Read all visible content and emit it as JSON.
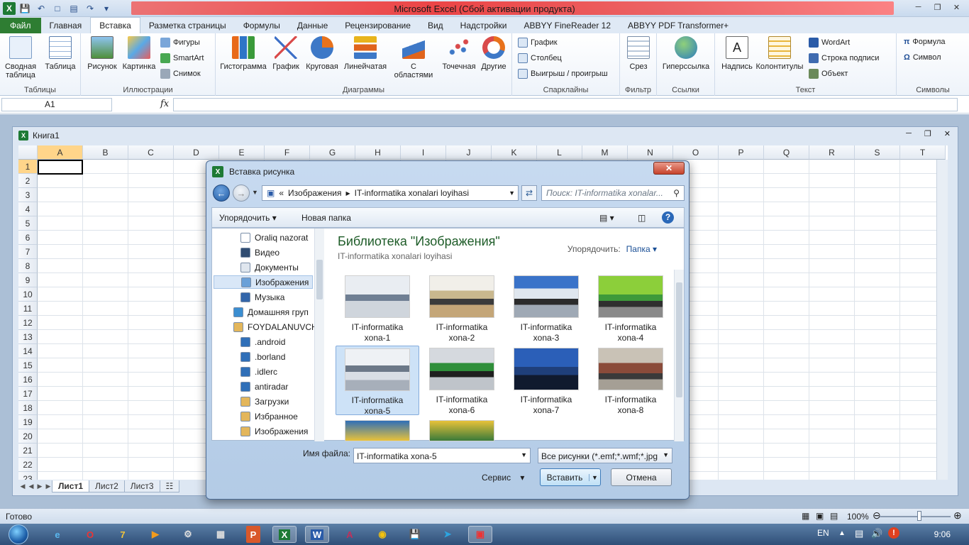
{
  "app": {
    "title": "Microsoft Excel (Сбой активации продукта)"
  },
  "ribbon": {
    "tabs": [
      "Файл",
      "Главная",
      "Вставка",
      "Разметка страницы",
      "Формулы",
      "Данные",
      "Рецензирование",
      "Вид",
      "Надстройки",
      "ABBYY FineReader 12",
      "ABBYY PDF Transformer+"
    ],
    "active_tab": "Вставка",
    "groups": {
      "tables": {
        "label": "Таблицы",
        "pivot": "Сводная таблица",
        "table": "Таблица"
      },
      "illustrations": {
        "label": "Иллюстрации",
        "picture": "Рисунок",
        "clipart": "Картинка",
        "shapes": "Фигуры",
        "smartart": "SmartArt",
        "screenshot": "Снимок"
      },
      "charts": {
        "label": "Диаграммы",
        "column": "Гистограмма",
        "line": "График",
        "pie": "Круговая",
        "bar": "Линейчатая",
        "area": "С областями",
        "scatter": "Точечная",
        "other": "Другие"
      },
      "sparklines": {
        "label": "Спарклайны",
        "line": "График",
        "column": "Столбец",
        "winloss": "Выигрыш / проигрыш"
      },
      "filter": {
        "label": "Фильтр",
        "slicer": "Срез"
      },
      "links": {
        "label": "Ссылки",
        "hyperlink": "Гиперссылка"
      },
      "text": {
        "label": "Текст",
        "textbox": "Надпись",
        "header": "Колонтитулы",
        "wordart": "WordArt",
        "signature": "Строка подписи",
        "object": "Объект"
      },
      "symbols": {
        "label": "Символы",
        "equation": "Формула",
        "symbol": "Символ"
      }
    }
  },
  "formula_bar": {
    "name_box": "A1",
    "fx": "fx",
    "value": ""
  },
  "workbook": {
    "title": "Книга1",
    "columns": [
      "A",
      "B",
      "C",
      "D",
      "E",
      "F",
      "G",
      "H",
      "I",
      "J",
      "K",
      "L",
      "M",
      "N",
      "O",
      "P",
      "Q",
      "R",
      "S",
      "T"
    ],
    "rows": [
      "1",
      "2",
      "3",
      "4",
      "5",
      "6",
      "7",
      "8",
      "9",
      "10",
      "11",
      "12",
      "13",
      "14",
      "15",
      "16",
      "17",
      "18",
      "19",
      "20",
      "21",
      "22",
      "23"
    ],
    "selected_cell": "A1",
    "sheets": [
      "Лист1",
      "Лист2",
      "Лист3"
    ],
    "active_sheet": "Лист1"
  },
  "status": {
    "ready": "Готово",
    "zoom": "100%"
  },
  "dialog": {
    "title": "Вставка рисунка",
    "breadcrumb": [
      "Изображения",
      "IT-informatika  xonalari loyihasi"
    ],
    "search_placeholder": "Поиск: IT-informatika  xonalar...",
    "organize": "Упорядочить",
    "new_folder": "Новая папка",
    "nav_items": [
      {
        "label": "Oraliq nazorat",
        "icon": "document-icon"
      },
      {
        "label": "Видео",
        "icon": "video-library-icon"
      },
      {
        "label": "Документы",
        "icon": "documents-library-icon"
      },
      {
        "label": "Изображения",
        "icon": "pictures-library-icon",
        "selected": true
      },
      {
        "label": "Музыка",
        "icon": "music-library-icon"
      },
      {
        "label": "Домашняя груп",
        "icon": "homegroup-icon"
      },
      {
        "label": "FOYDALANUVCH",
        "icon": "user-folder-icon"
      },
      {
        "label": ".android",
        "icon": "folder-icon"
      },
      {
        "label": ".borland",
        "icon": "folder-icon"
      },
      {
        "label": ".idlerc",
        "icon": "folder-icon"
      },
      {
        "label": "antiradar",
        "icon": "folder-icon"
      },
      {
        "label": "Загрузки",
        "icon": "downloads-folder-icon"
      },
      {
        "label": "Избранное",
        "icon": "favorites-folder-icon"
      },
      {
        "label": "Изображения",
        "icon": "pictures-folder-icon"
      }
    ],
    "library_title": "Библиотека \"Изображения\"",
    "library_sub": "IT-informatika  xonalari loyihasi",
    "arrange_label": "Упорядочить:",
    "arrange_value": "Папка",
    "thumbnails": [
      {
        "line1": "IT-informatika",
        "line2": "xona-1"
      },
      {
        "line1": "IT-informatika",
        "line2": "xona-2"
      },
      {
        "line1": "IT-informatika",
        "line2": "xona-3"
      },
      {
        "line1": "IT-informatika",
        "line2": "xona-4"
      },
      {
        "line1": "IT-informatika",
        "line2": "xona-5",
        "selected": true
      },
      {
        "line1": "IT-informatika",
        "line2": "xona-6"
      },
      {
        "line1": "IT-informatika",
        "line2": "xona-7"
      },
      {
        "line1": "IT-informatika",
        "line2": "xona-8"
      }
    ],
    "filename_label": "Имя файла:",
    "filename_value": "IT-informatika xona-5",
    "filetype": "Все рисунки (*.emf;*.wmf;*.jpg",
    "service": "Сервис",
    "insert": "Вставить",
    "cancel": "Отмена"
  },
  "taskbar": {
    "lang": "EN",
    "time": "9:06"
  }
}
